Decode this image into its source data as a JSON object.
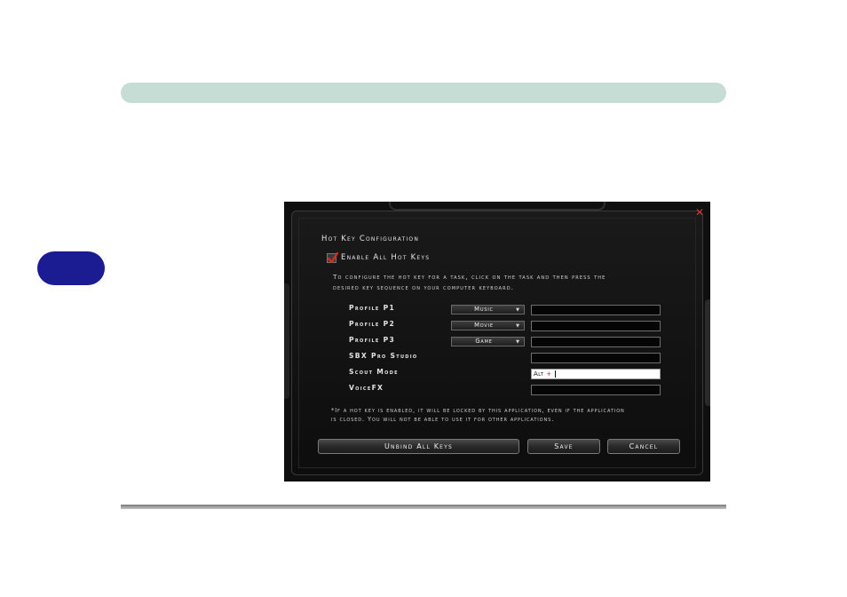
{
  "page": {
    "chapter_tab_color": "#1c1c92",
    "header_bar_color": "#c6ddd6"
  },
  "dialog": {
    "close_icon": "close-icon",
    "title": "Hot Key Configuration",
    "enable_all": {
      "label": "Enable All Hot Keys",
      "checked": true
    },
    "instructions": [
      "To configure the hot key for a task, click on the task and then press the",
      "desired key sequence on your computer keyboard."
    ],
    "rows": [
      {
        "label": "Profile P1",
        "select": "Music",
        "value": ""
      },
      {
        "label": "Profile P2",
        "select": "Movie",
        "value": ""
      },
      {
        "label": "Profile P3",
        "select": "Game",
        "value": ""
      },
      {
        "label": "SBX Pro Studio",
        "value": ""
      },
      {
        "label": "Scout Mode",
        "value_key": "Alt",
        "value_plus": "+"
      },
      {
        "label": "VoiceFX",
        "value": ""
      }
    ],
    "note": [
      "*If a hot key is enabled, it will be locked by this application, even if the application",
      "is closed. You will not be able to use it for other applications."
    ],
    "buttons": {
      "unbind": "Unbind All Keys",
      "save": "Save",
      "cancel": "Cancel"
    }
  }
}
